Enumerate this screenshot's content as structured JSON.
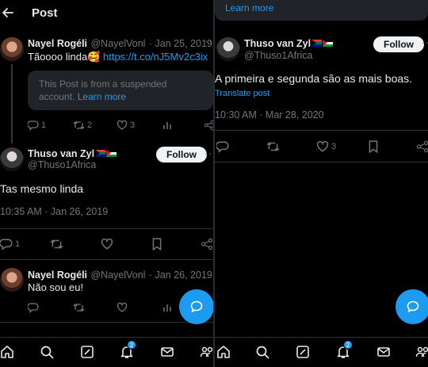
{
  "colors": {
    "accent": "#1d9bf0",
    "muted": "#71767b",
    "text": "#e7e9ea",
    "background": "#000000"
  },
  "left": {
    "header": {
      "title": "Post",
      "back_icon": "back-arrow-icon"
    },
    "post1": {
      "name": "Nayel Rogéli",
      "handle": "@NayelVonl",
      "date": "· Jan 25, 2019",
      "text": "Tãoooo linda🥰",
      "link": "https://t.co/nJ5Mv2c3ix",
      "quote_text_1": "This Post is from a suspended",
      "quote_text_2": "account.",
      "quote_link": "Learn more",
      "replies": "1",
      "reposts": "2",
      "likes": "3"
    },
    "post2": {
      "name": "Thuso van Zyl",
      "handle": "@Thuso1Africa",
      "follow": "Follow",
      "text": "Tas mesmo linda",
      "timestamp": "10:35 AM · Jan 26, 2019",
      "replies": "1"
    },
    "post3": {
      "name": "Nayel Rogéli",
      "handle": "@NayelVonl",
      "date": "· Jan 26, 2019",
      "text": "Não sou eu!"
    },
    "nav": {
      "notification_count": "2"
    }
  },
  "right": {
    "top_link": "Learn more",
    "post": {
      "name": "Thuso van Zyl",
      "handle": "@Thuso1Africa",
      "follow": "Follow",
      "text": "A primeira e segunda são as mais boas.",
      "translate": "Translate post",
      "timestamp": "10:30 AM · Mar 28, 2020",
      "likes": "3"
    },
    "nav": {
      "notification_count": "2"
    }
  }
}
